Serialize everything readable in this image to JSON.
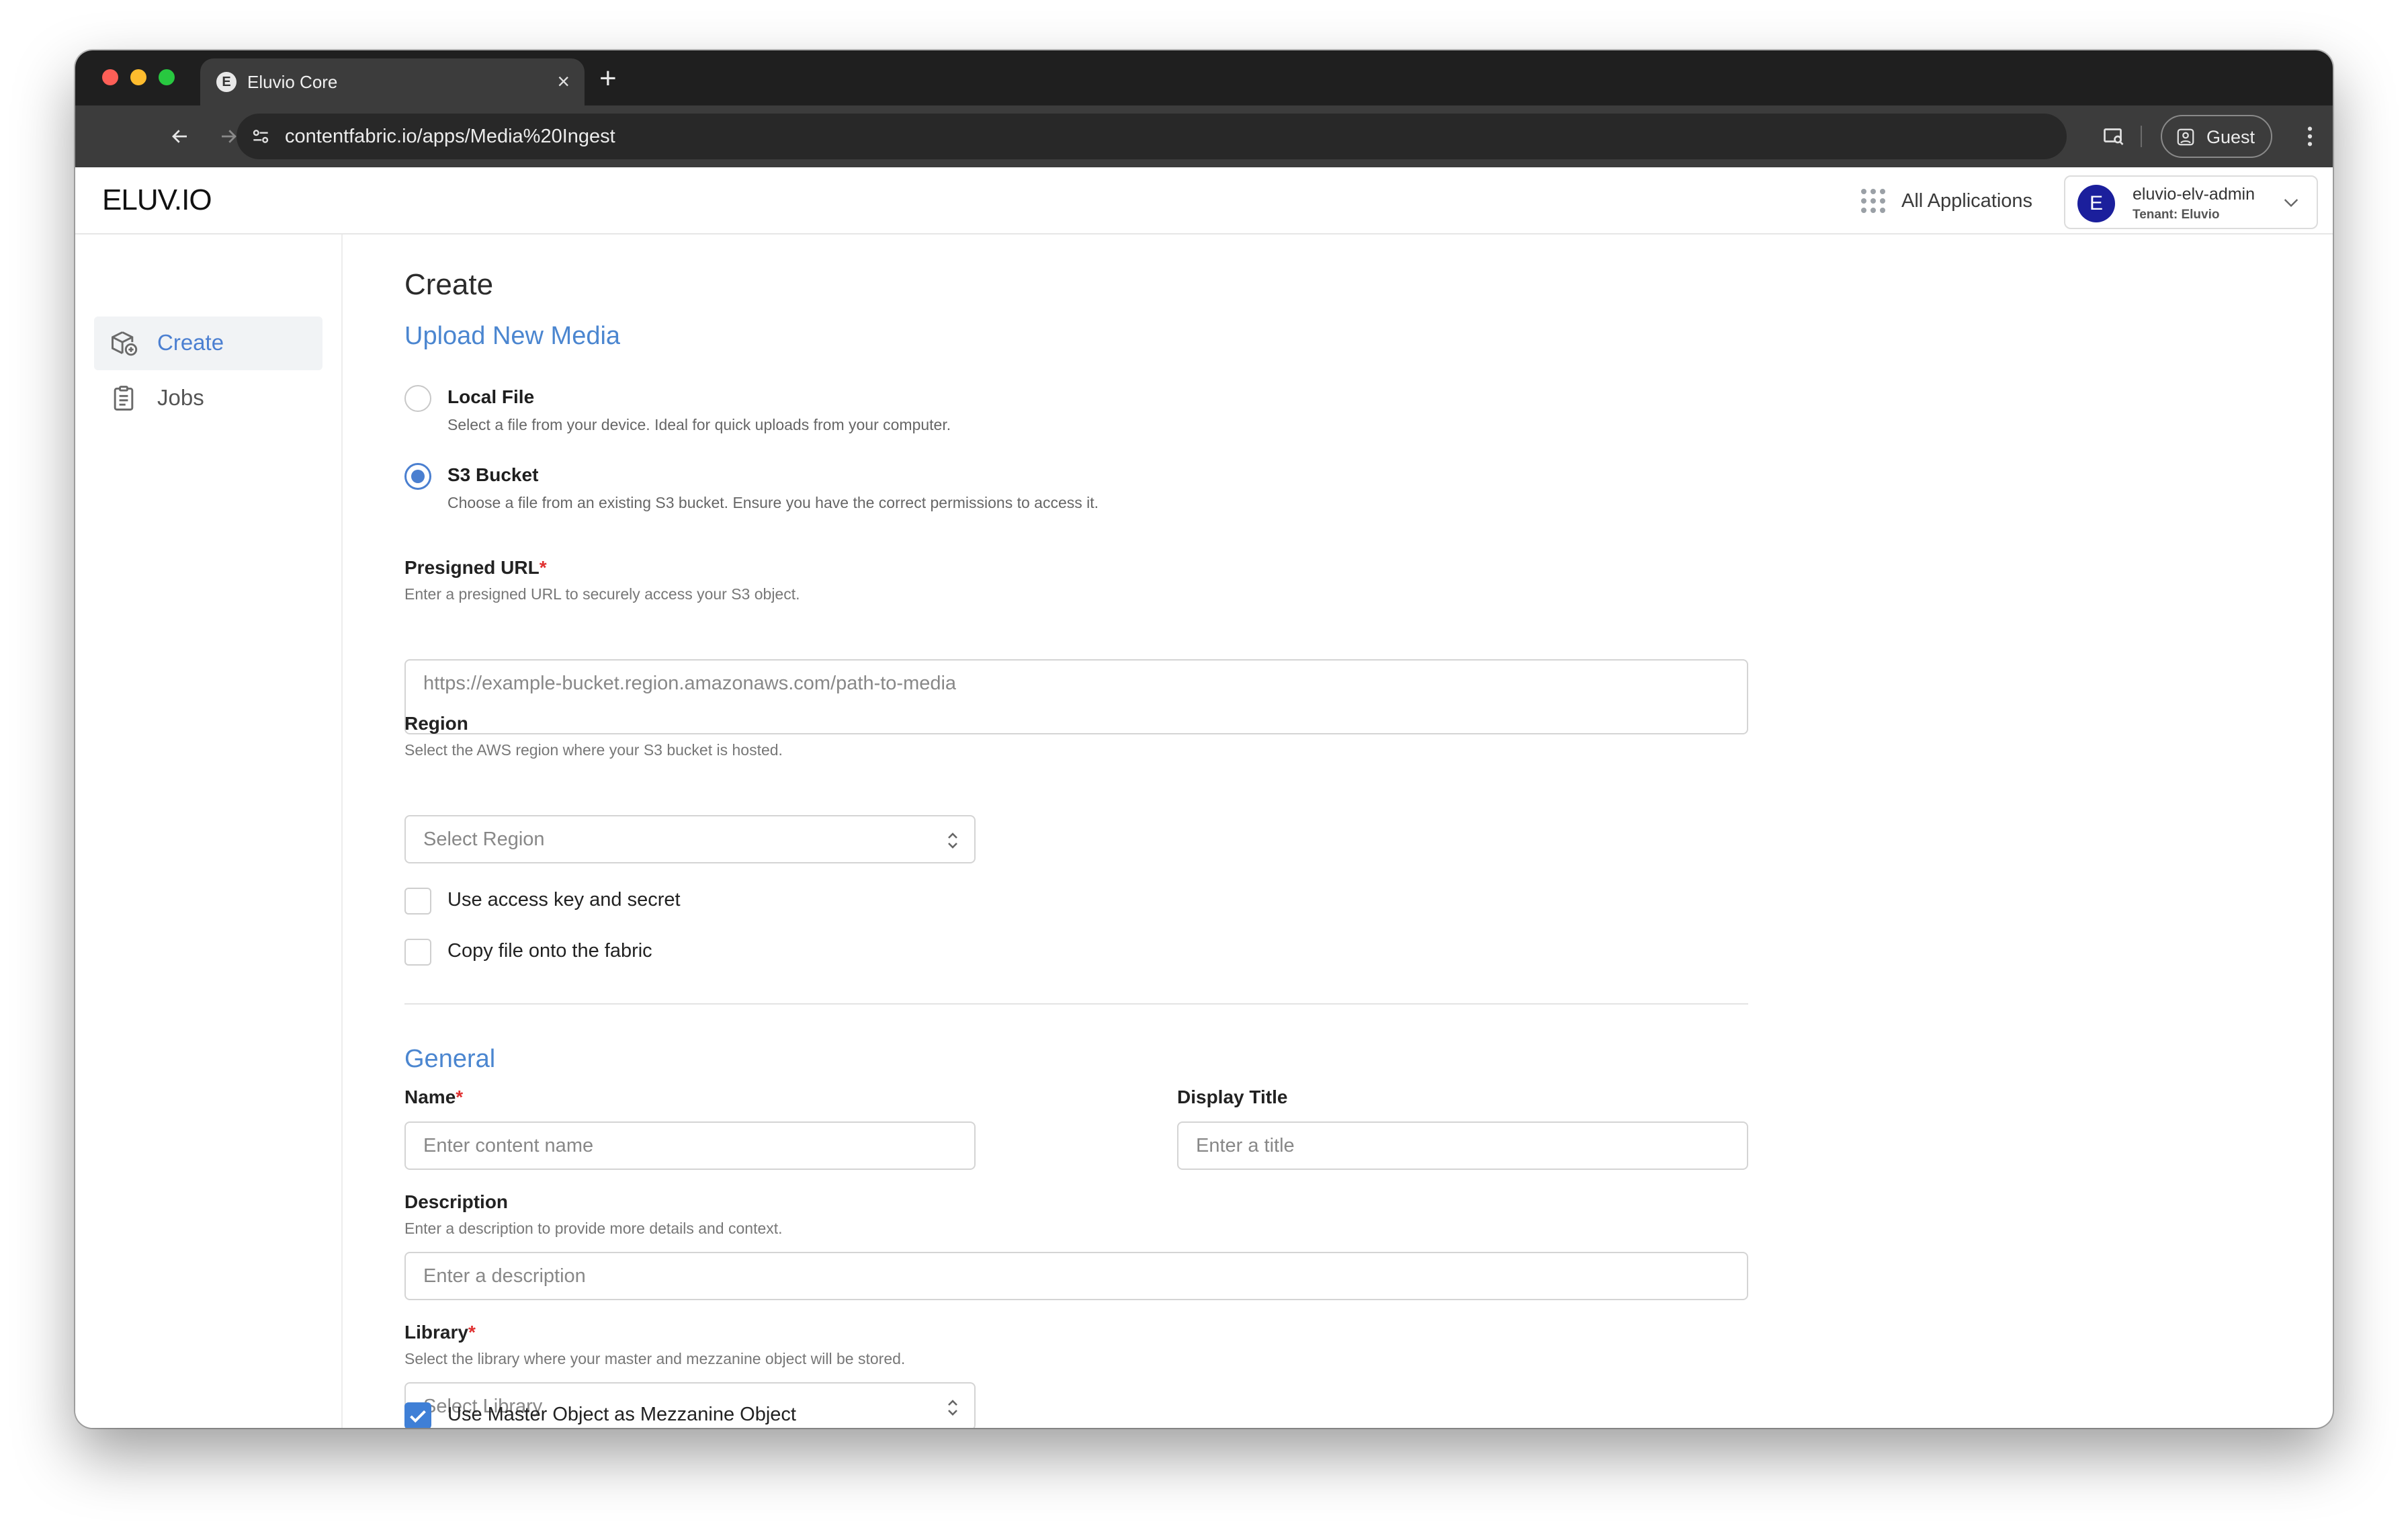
{
  "browser": {
    "tab_title": "Eluvio Core",
    "tab_favicon_letter": "E",
    "url": "contentfabric.io/apps/Media%20Ingest",
    "profile_label": "Guest"
  },
  "header": {
    "logo": "ELUV.IO",
    "all_apps_label": "All Applications",
    "user": {
      "avatar_letter": "E",
      "name": "eluvio-elv-admin",
      "tenant": "Tenant: Eluvio",
      "avatar_color": "#1b1f9c"
    }
  },
  "sidebar": {
    "items": [
      {
        "label": "Create",
        "icon": "create-box-icon",
        "active": true
      },
      {
        "label": "Jobs",
        "icon": "clipboard-icon",
        "active": false
      }
    ]
  },
  "main": {
    "title": "Create",
    "upload": {
      "heading": "Upload New Media",
      "options": [
        {
          "label": "Local File",
          "desc": "Select a file from your device. Ideal for quick uploads from your computer.",
          "selected": false
        },
        {
          "label": "S3 Bucket",
          "desc": "Choose a file from an existing S3 bucket. Ensure you have the correct permissions to access it.",
          "selected": true
        }
      ],
      "presigned": {
        "label": "Presigned URL",
        "required": "*",
        "desc": "Enter a presigned URL to securely access your S3 object.",
        "placeholder": "https://example-bucket.region.amazonaws.com/path-to-media"
      },
      "region": {
        "label": "Region",
        "desc": "Select the AWS region where your S3 bucket is hosted.",
        "placeholder": "Select Region"
      },
      "checkboxes": [
        {
          "label": "Use access key and secret",
          "checked": false
        },
        {
          "label": "Copy file onto the fabric",
          "checked": false
        }
      ]
    },
    "general": {
      "heading": "General",
      "name": {
        "label": "Name",
        "required": "*",
        "placeholder": "Enter content name"
      },
      "display_title": {
        "label": "Display Title",
        "placeholder": "Enter a title"
      },
      "description": {
        "label": "Description",
        "desc": "Enter a description to provide more details and context.",
        "placeholder": "Enter a description"
      },
      "library": {
        "label": "Library",
        "required": "*",
        "desc": "Select the library where your master and mezzanine object will be stored.",
        "placeholder": "Select Library"
      },
      "master_as_mezz": {
        "label": "Use Master Object as Mezzanine Object",
        "checked": true
      }
    }
  },
  "colors": {
    "accent": "#4b86d0",
    "required": "#e03131",
    "checkbox_checked": "#3f7fd6"
  }
}
